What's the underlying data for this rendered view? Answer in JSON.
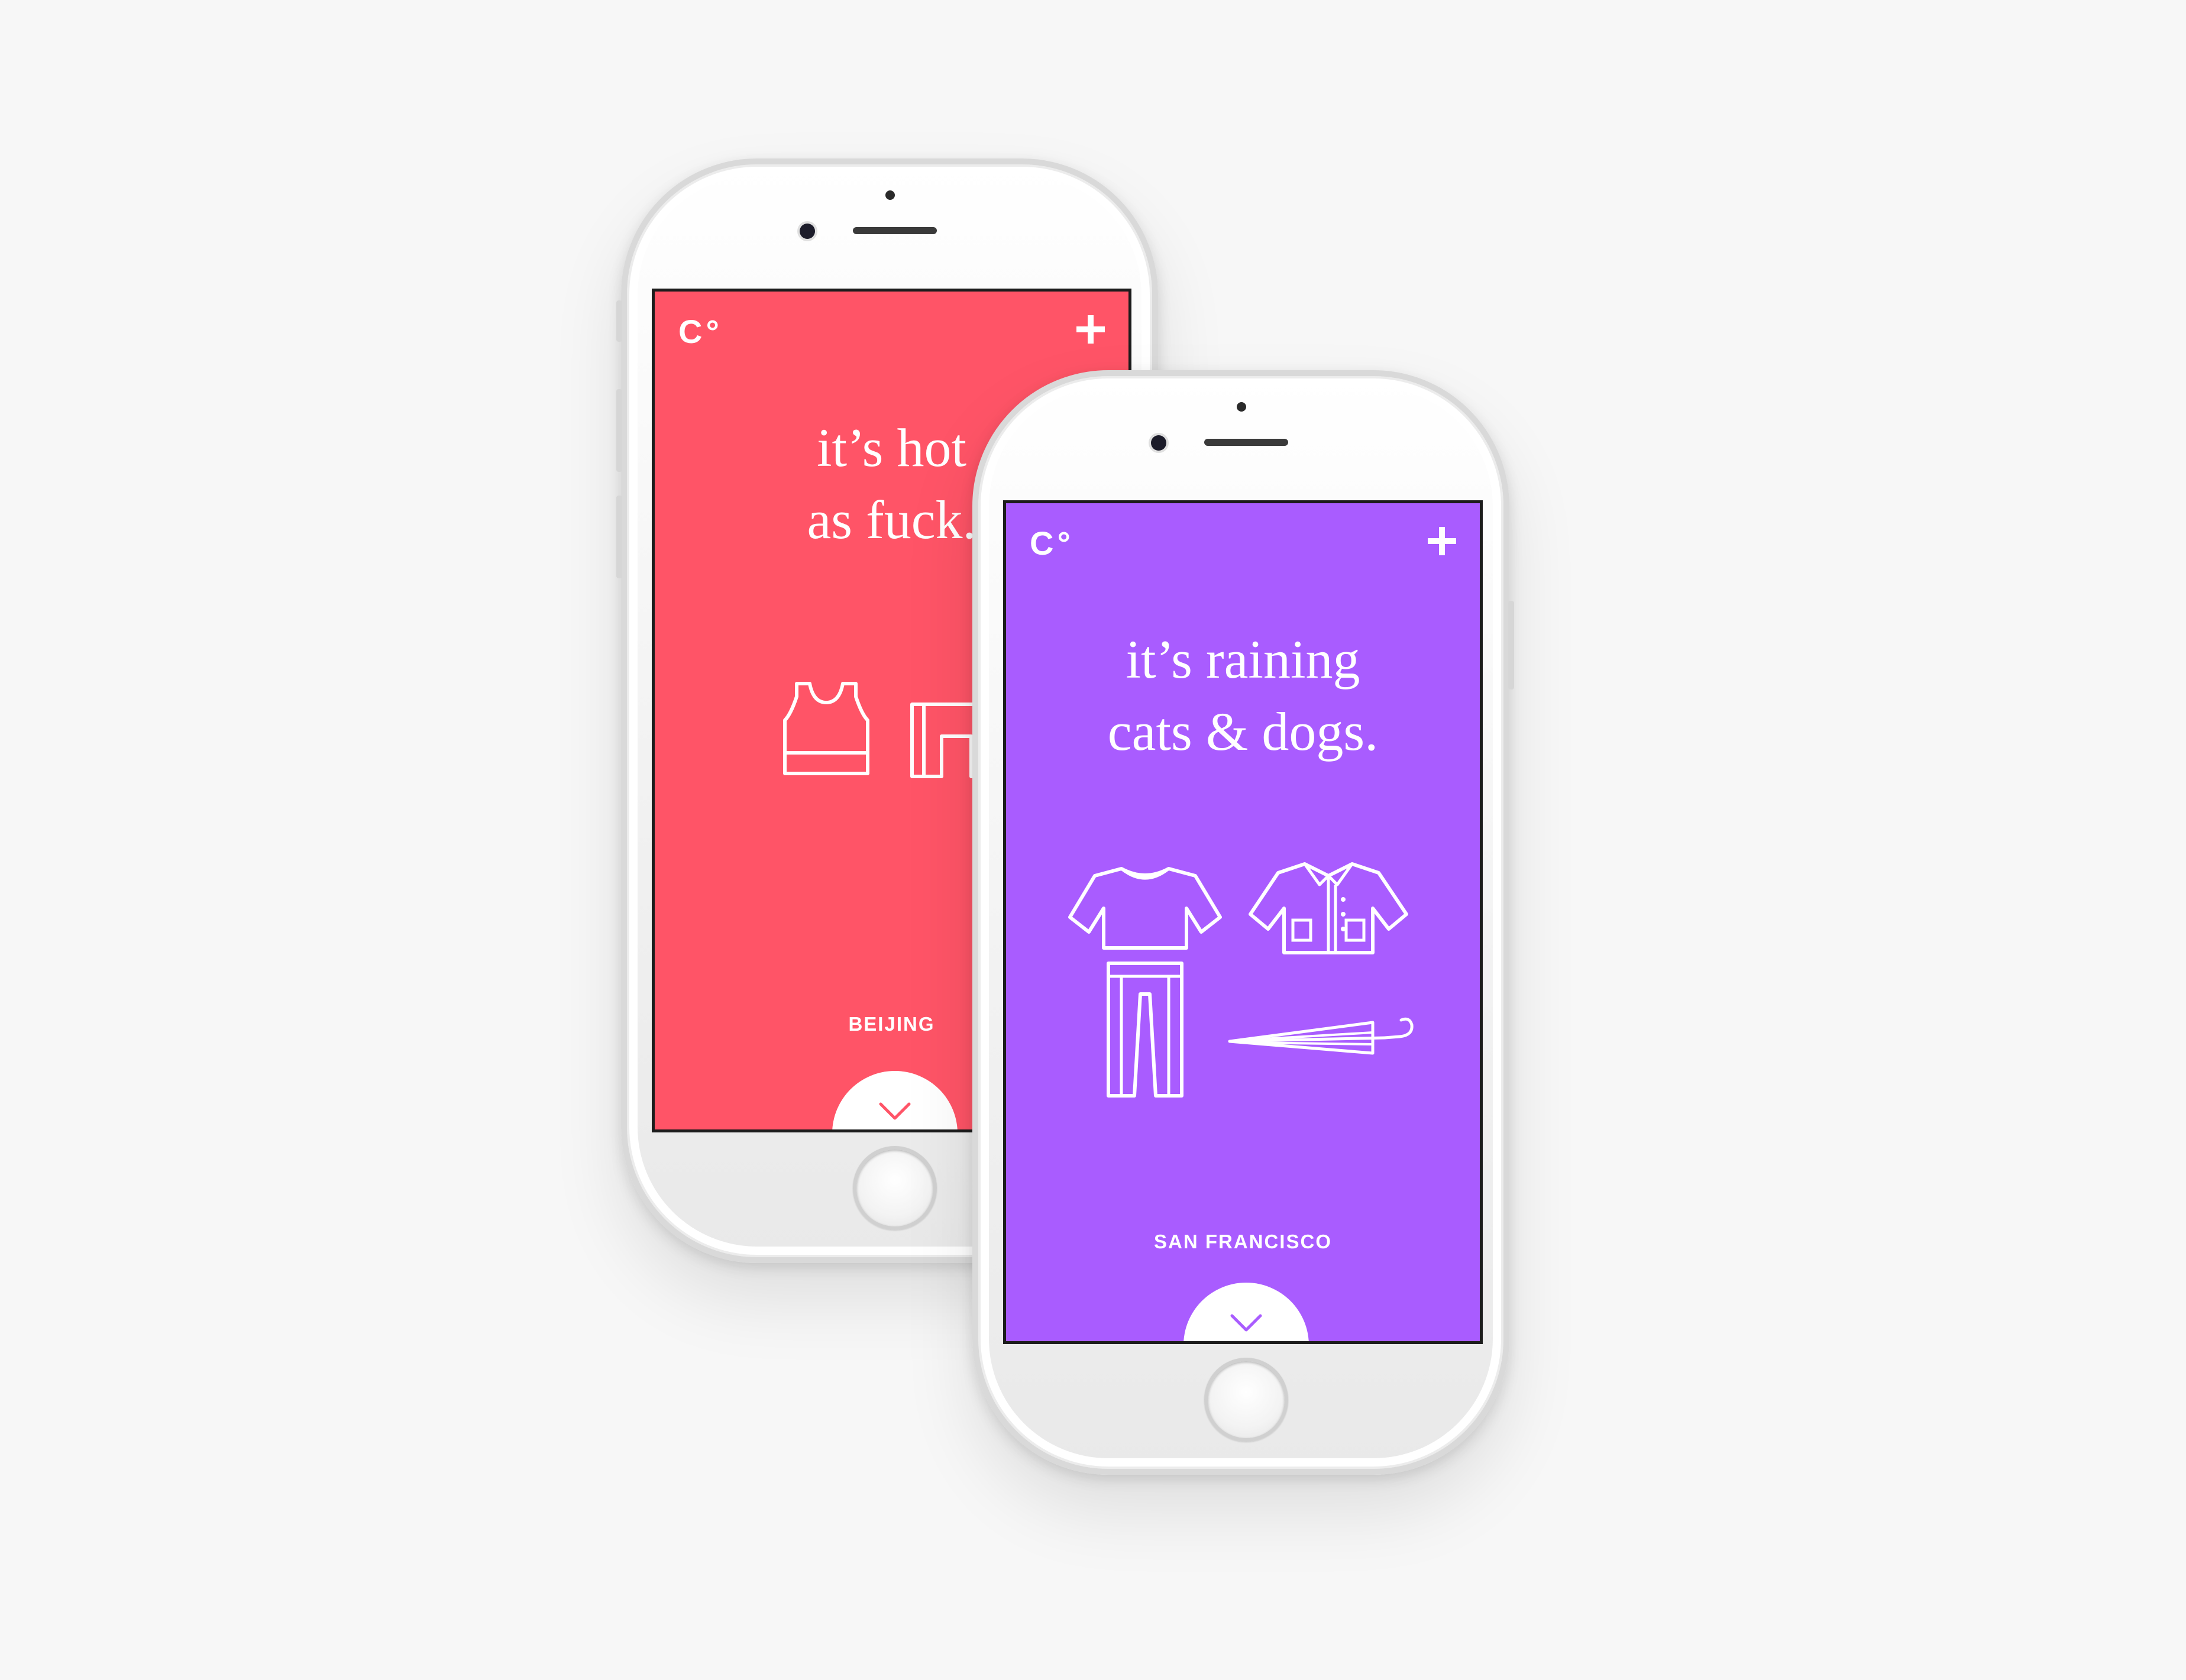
{
  "phones": [
    {
      "city": "BEIJING",
      "accent": "#ff5467",
      "headline": [
        "it’s hot",
        "as fuck."
      ],
      "logo": "C°",
      "icons": [
        "tank-top-icon",
        "shorts-icon"
      ],
      "add_icon": "plus-icon",
      "scroll_icon": "chevron-down-icon"
    },
    {
      "city": "SAN FRANCISCO",
      "accent": "#a95cff",
      "headline": [
        "it’s raining",
        "cats & dogs."
      ],
      "logo": "C°",
      "icons": [
        "long-sleeve-shirt-icon",
        "raincoat-icon",
        "pants-icon",
        "umbrella-icon"
      ],
      "add_icon": "plus-icon",
      "scroll_icon": "chevron-down-icon"
    }
  ]
}
